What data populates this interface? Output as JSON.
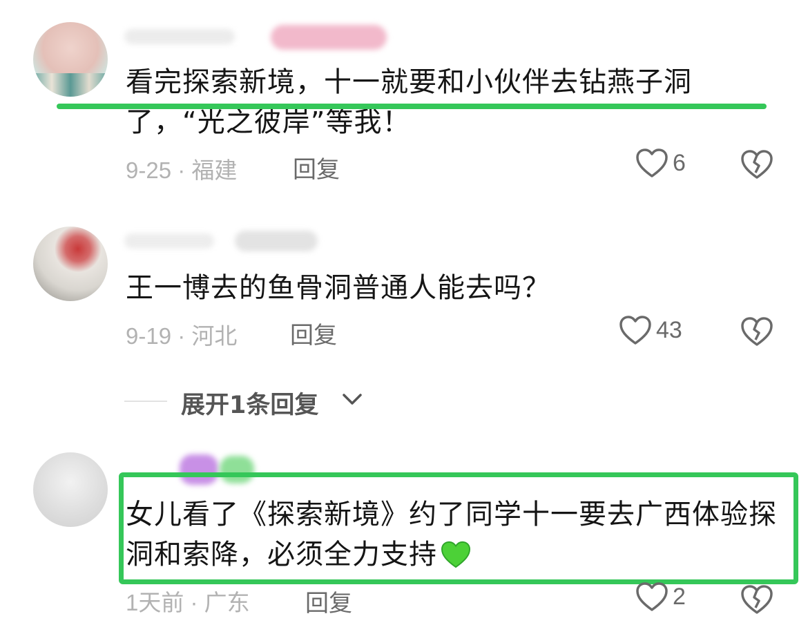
{
  "comments": [
    {
      "text": "看完探索新境，十一就要和小伙伴去钻燕子洞了，“光之彼岸”等我！",
      "meta": "9-25 · 福建",
      "reply_label": "回复",
      "likes": "6"
    },
    {
      "text": "王一博去的鱼骨洞普通人能去吗？",
      "meta": "9-19 · 河北",
      "reply_label": "回复",
      "likes": "43"
    },
    {
      "text": "女儿看了《探索新境》约了同学十一要去广西体验探洞和索降，必须全力支持",
      "meta": "1天前 · 广东",
      "reply_label": "回复",
      "likes": "2",
      "emoji": "green-heart"
    }
  ],
  "expand_replies": "展开1条回复",
  "colors": {
    "highlight": "#35c759",
    "meta_text": "#b2b2b2",
    "action_text": "#6a6a6a"
  },
  "icons": [
    "heart-outline-icon",
    "broken-heart-icon",
    "chevron-down-icon",
    "green-heart-emoji"
  ]
}
